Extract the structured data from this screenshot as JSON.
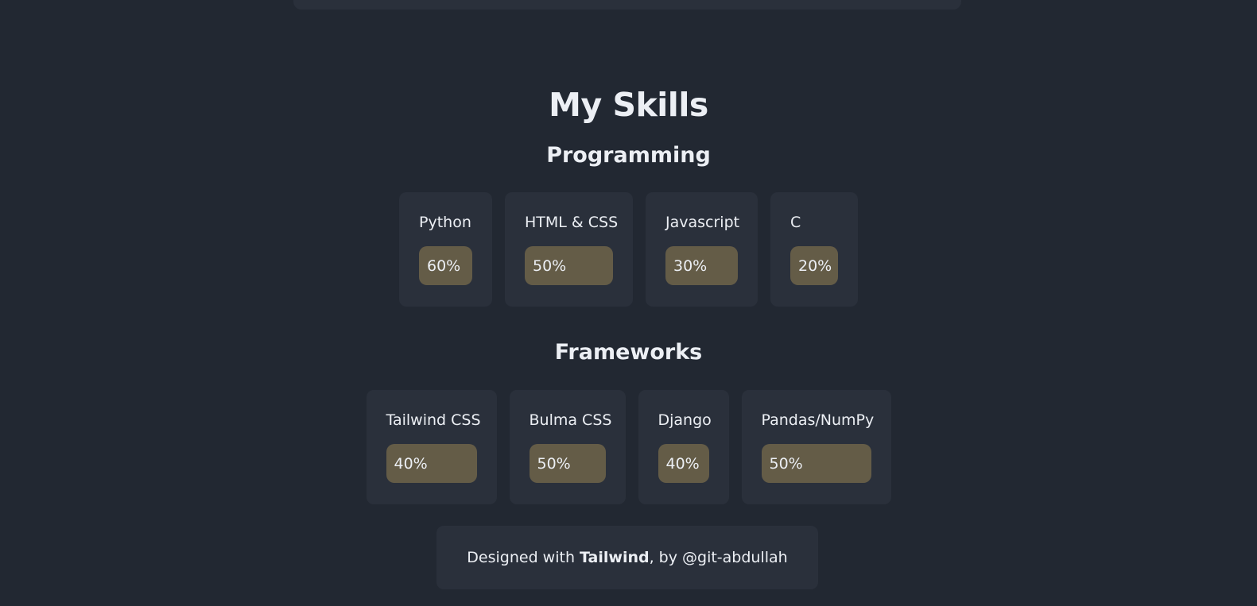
{
  "skills": {
    "title": "My Skills",
    "programming": {
      "heading": "Programming",
      "items": [
        {
          "name": "Python",
          "level": "60%"
        },
        {
          "name": "HTML & CSS",
          "level": "50%"
        },
        {
          "name": "Javascript",
          "level": "30%"
        },
        {
          "name": "C",
          "level": "20%"
        }
      ]
    },
    "frameworks": {
      "heading": "Frameworks",
      "items": [
        {
          "name": "Tailwind CSS",
          "level": "40%"
        },
        {
          "name": "Bulma CSS",
          "level": "50%"
        },
        {
          "name": "Django",
          "level": "40%"
        },
        {
          "name": "Pandas/NumPy",
          "level": "50%"
        }
      ]
    }
  },
  "footer": {
    "prefix": "Designed with ",
    "brand": "Tailwind",
    "suffix": ", by @git-abdullah"
  },
  "colors": {
    "background": "#222832",
    "card": "#2a303b",
    "badge": "#645c47",
    "text": "#eceff4"
  }
}
